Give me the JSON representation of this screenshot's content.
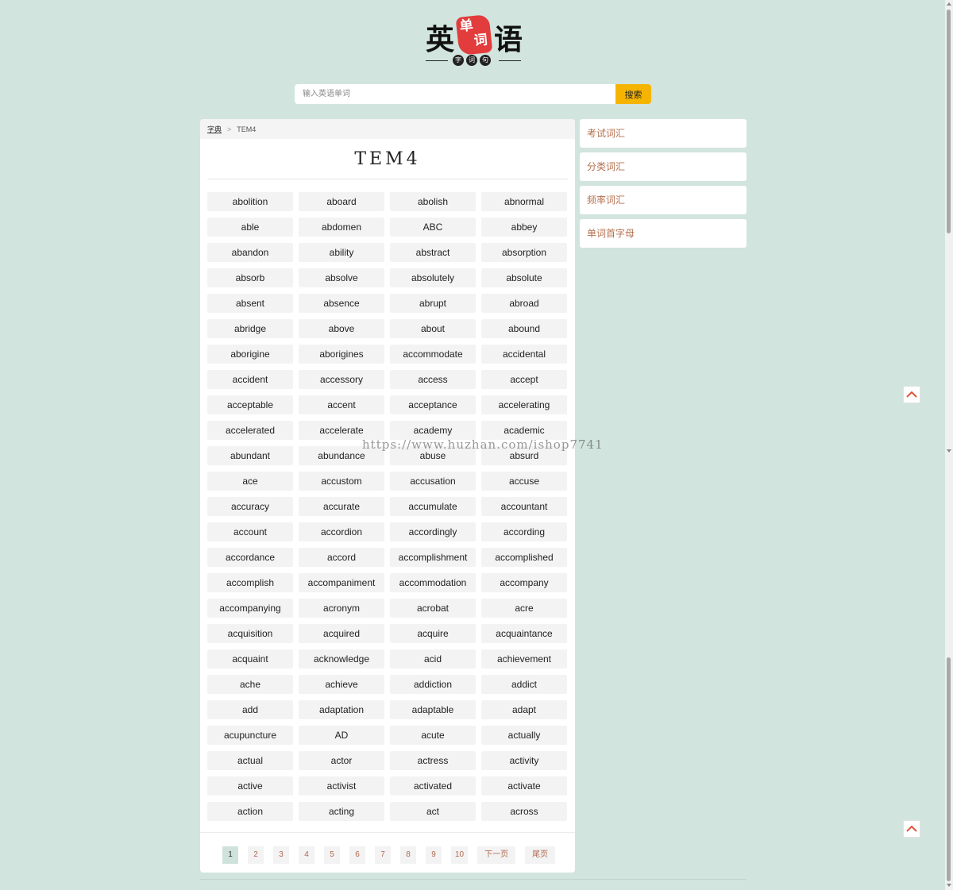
{
  "logo": {
    "left_char": "英",
    "right_char": "语",
    "stamp_chars": [
      "单",
      "词"
    ],
    "dot_chars": [
      "字",
      "词",
      "句"
    ]
  },
  "search": {
    "placeholder": "输入英语单词",
    "button_label": "搜索"
  },
  "breadcrumb": {
    "home": "字典",
    "separator": ">",
    "current": "TEM4"
  },
  "page_title": "TEM4",
  "words": [
    "abolition",
    "aboard",
    "abolish",
    "abnormal",
    "able",
    "abdomen",
    "ABC",
    "abbey",
    "abandon",
    "ability",
    "abstract",
    "absorption",
    "absorb",
    "absolve",
    "absolutely",
    "absolute",
    "absent",
    "absence",
    "abrupt",
    "abroad",
    "abridge",
    "above",
    "about",
    "abound",
    "aborigine",
    "aborigines",
    "accommodate",
    "accidental",
    "accident",
    "accessory",
    "access",
    "accept",
    "acceptable",
    "accent",
    "acceptance",
    "accelerating",
    "accelerated",
    "accelerate",
    "academy",
    "academic",
    "abundant",
    "abundance",
    "abuse",
    "absurd",
    "ace",
    "accustom",
    "accusation",
    "accuse",
    "accuracy",
    "accurate",
    "accumulate",
    "accountant",
    "account",
    "accordion",
    "accordingly",
    "according",
    "accordance",
    "accord",
    "accomplishment",
    "accomplished",
    "accomplish",
    "accompaniment",
    "accommodation",
    "accompany",
    "accompanying",
    "acronym",
    "acrobat",
    "acre",
    "acquisition",
    "acquired",
    "acquire",
    "acquaintance",
    "acquaint",
    "acknowledge",
    "acid",
    "achievement",
    "ache",
    "achieve",
    "addiction",
    "addict",
    "add",
    "adaptation",
    "adaptable",
    "adapt",
    "acupuncture",
    "AD",
    "acute",
    "actually",
    "actual",
    "actor",
    "actress",
    "activity",
    "active",
    "activist",
    "activated",
    "activate",
    "action",
    "acting",
    "act",
    "across"
  ],
  "pagination": {
    "pages": [
      "1",
      "2",
      "3",
      "4",
      "5",
      "6",
      "7",
      "8",
      "9",
      "10"
    ],
    "current": "1",
    "next_label": "下一页",
    "last_label": "尾页"
  },
  "sidebar": {
    "items": [
      {
        "label": "考试词汇"
      },
      {
        "label": "分类词汇"
      },
      {
        "label": "频率词汇"
      },
      {
        "label": "单词首字母"
      }
    ]
  },
  "watermark": "https://www.huzhan.com/ishop7741",
  "colors": {
    "background": "#d2e4de",
    "search_button": "#f5b400",
    "sidebar_text": "#b4704f",
    "pager_text": "#b06a50",
    "pager_active": "#cfe3dc",
    "logo_stamp": "#e23c3c",
    "to_top_arrow": "#e0533a"
  },
  "icons": {
    "to_top": "chevron-up-icon"
  }
}
